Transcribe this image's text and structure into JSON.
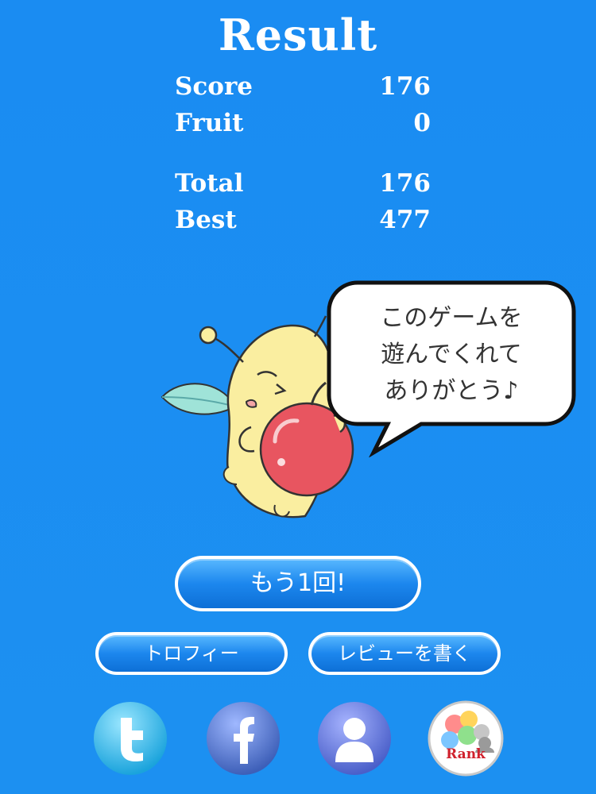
{
  "result": {
    "title": "Result",
    "rows": [
      {
        "label": "Score",
        "value": "176"
      },
      {
        "label": "Fruit",
        "value": "0"
      },
      {
        "label": "Total",
        "value": "176"
      },
      {
        "label": "Best",
        "value": "477"
      }
    ]
  },
  "speech": {
    "lines": [
      "このゲームを",
      "遊んでくれて",
      "ありがとう♪"
    ]
  },
  "buttons": {
    "retry": "もう1回!",
    "trophy": "トロフィー",
    "review": "レビューを書く"
  },
  "social": {
    "rank_label": "Rank",
    "icons": [
      "twitter-icon",
      "facebook-icon",
      "profile-icon",
      "rank-icon"
    ]
  },
  "colors": {
    "background": "#1b8ef0",
    "button": "#1c87ee",
    "apple": "#e85560",
    "creature": "#faeea0"
  }
}
